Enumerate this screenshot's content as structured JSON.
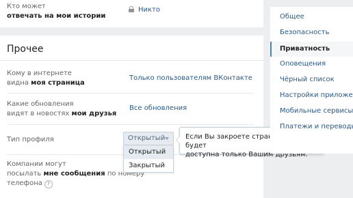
{
  "privacy_top": {
    "label_line1": "Кто может",
    "label_line2": "отвечать на мои истории",
    "value": "Никто"
  },
  "section": {
    "title": "Прочее",
    "rows": [
      {
        "label_prefix": "Кому в интернете",
        "label_suffix_plain": "видна ",
        "label_bold": "моя страница",
        "value": "Только пользователям ВКонтакте"
      },
      {
        "label_prefix": "Какие обновления",
        "label_suffix_plain": "видят в новостях ",
        "label_bold": "мои друзья",
        "value": "Все обновления"
      },
      {
        "label": "Тип профиля"
      },
      {
        "label_line1": "Компании могут",
        "label_plain": "посылать ",
        "label_bold": "мне сообщения",
        "label_plain_after": " по номеру",
        "label_line3": "телефона",
        "help": "?"
      }
    ]
  },
  "profile_type": {
    "selected": "Открытый",
    "options": [
      "Открытый",
      "Закрытый"
    ]
  },
  "tooltip": {
    "line1": "Если Вы закроете страницу, она будет",
    "line2": "доступна только Вашим друзьям."
  },
  "sidebar": {
    "items": [
      {
        "label": "Общее"
      },
      {
        "label": "Безопасность"
      },
      {
        "label": "Приватность",
        "active": true
      },
      {
        "label": "Оповещения"
      },
      {
        "label": "Чёрный список"
      },
      {
        "label": "Настройки приложений"
      },
      {
        "label": "Мобильные сервисы"
      },
      {
        "label": "Платежи и переводы"
      }
    ]
  },
  "colors": {
    "accent": "#5181b8",
    "link": "#2a5885",
    "background": "#edeef0"
  },
  "icons": {
    "lock": "lock-icon",
    "caret": "chevron-down-icon",
    "help": "question-icon"
  }
}
